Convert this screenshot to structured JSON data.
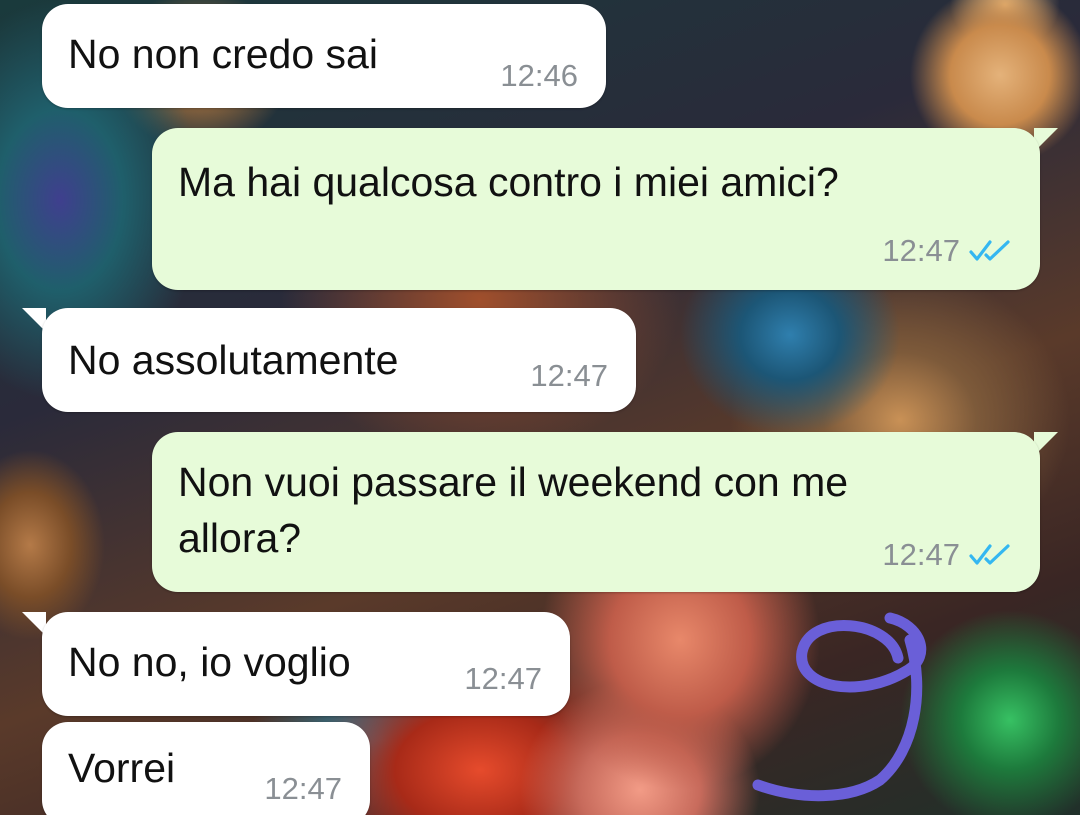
{
  "chat": {
    "messages": [
      {
        "direction": "incoming",
        "text": "No non credo sai",
        "time": "12:46"
      },
      {
        "direction": "outgoing",
        "text": "Ma hai qualcosa contro i miei amici?",
        "time": "12:47",
        "status": "read"
      },
      {
        "direction": "incoming",
        "text": "No assolutamente",
        "time": "12:47"
      },
      {
        "direction": "outgoing",
        "text_line1": "Non vuoi passare il weekend con me",
        "text_line2": "allora?",
        "time": "12:47",
        "status": "read"
      },
      {
        "direction": "incoming",
        "text": "No no, io voglio",
        "time": "12:47"
      },
      {
        "direction": "incoming",
        "text": "Vorrei",
        "time": "12:47"
      }
    ]
  },
  "colors": {
    "incoming_bubble": "#ffffff",
    "outgoing_bubble": "#e7fbd9",
    "read_ticks": "#34b7f1",
    "timestamp": "#8a8f94",
    "scribble": "#6a5fd8"
  },
  "icons": {
    "read_status": "double-check-icon"
  },
  "annotation": {
    "handwritten_mark": "9"
  }
}
